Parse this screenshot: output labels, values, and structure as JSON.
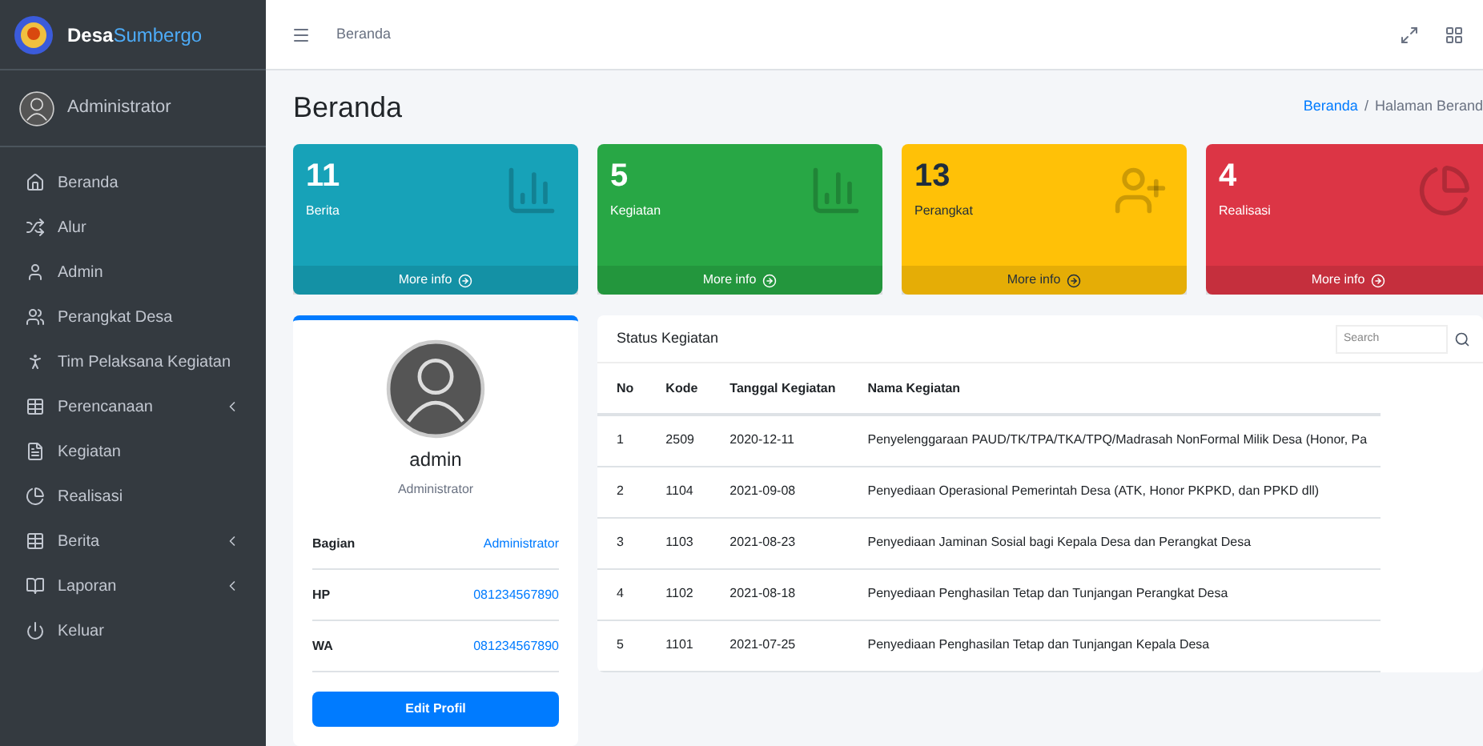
{
  "brand": {
    "part_1": "Desa",
    "part_2": "Sumbergo"
  },
  "sidebar_user": "Administrator",
  "sidebar": {
    "items": [
      {
        "label": "Beranda",
        "submenu": false
      },
      {
        "label": "Alur",
        "submenu": false
      },
      {
        "label": "Admin",
        "submenu": false
      },
      {
        "label": "Perangkat Desa",
        "submenu": false
      },
      {
        "label": "Tim Pelaksana Kegiatan",
        "submenu": false
      },
      {
        "label": "Perencanaan",
        "submenu": true
      },
      {
        "label": "Kegiatan",
        "submenu": false
      },
      {
        "label": "Realisasi",
        "submenu": false
      },
      {
        "label": "Berita",
        "submenu": true
      },
      {
        "label": "Laporan",
        "submenu": true
      },
      {
        "label": "Keluar",
        "submenu": false
      }
    ]
  },
  "topbar": {
    "breadcrumb": "Beranda"
  },
  "page": {
    "title": "Beranda",
    "breadcrumb": [
      "Beranda",
      "/",
      "Halaman Berand"
    ]
  },
  "stats": [
    {
      "value": "11",
      "label": "Berita",
      "link": "More info",
      "color": "#17a2b8",
      "dark_text": false
    },
    {
      "value": "5",
      "label": "Kegiatan",
      "link": "More info",
      "color": "#28a745",
      "dark_text": false
    },
    {
      "value": "13",
      "label": "Perangkat",
      "link": "More info",
      "color": "#ffc107",
      "dark_text": true
    },
    {
      "value": "4",
      "label": "Realisasi",
      "link": "More info",
      "color": "#dc3545",
      "dark_text": false
    }
  ],
  "profile": {
    "name": "admin",
    "role": "Administrator",
    "fields": [
      {
        "label": "Bagian",
        "value": "Administrator"
      },
      {
        "label": "HP",
        "value": "081234567890"
      },
      {
        "label": "WA",
        "value": "081234567890"
      }
    ],
    "button": "Edit Profil"
  },
  "table": {
    "title": "Status Kegiatan",
    "search": {
      "placeholder": "Search"
    },
    "columns": [
      "No",
      "Kode",
      "Tanggal Kegiatan",
      "Nama Kegiatan"
    ],
    "rows": [
      [
        "1",
        "2509",
        "2020-12-11",
        "Penyelenggaraan PAUD/TK/TPA/TKA/TPQ/Madrasah NonFormal Milik Desa (Honor, Pa"
      ],
      [
        "2",
        "1104",
        "2021-09-08",
        "Penyediaan Operasional Pemerintah Desa (ATK, Honor PKPKD, dan PPKD dll)"
      ],
      [
        "3",
        "1103",
        "2021-08-23",
        "Penyediaan Jaminan Sosial bagi Kepala Desa dan Perangkat Desa"
      ],
      [
        "4",
        "1102",
        "2021-08-18",
        "Penyediaan Penghasilan Tetap dan Tunjangan Perangkat Desa"
      ],
      [
        "5",
        "1101",
        "2021-07-25",
        "Penyediaan Penghasilan Tetap dan Tunjangan Kepala Desa"
      ]
    ]
  }
}
